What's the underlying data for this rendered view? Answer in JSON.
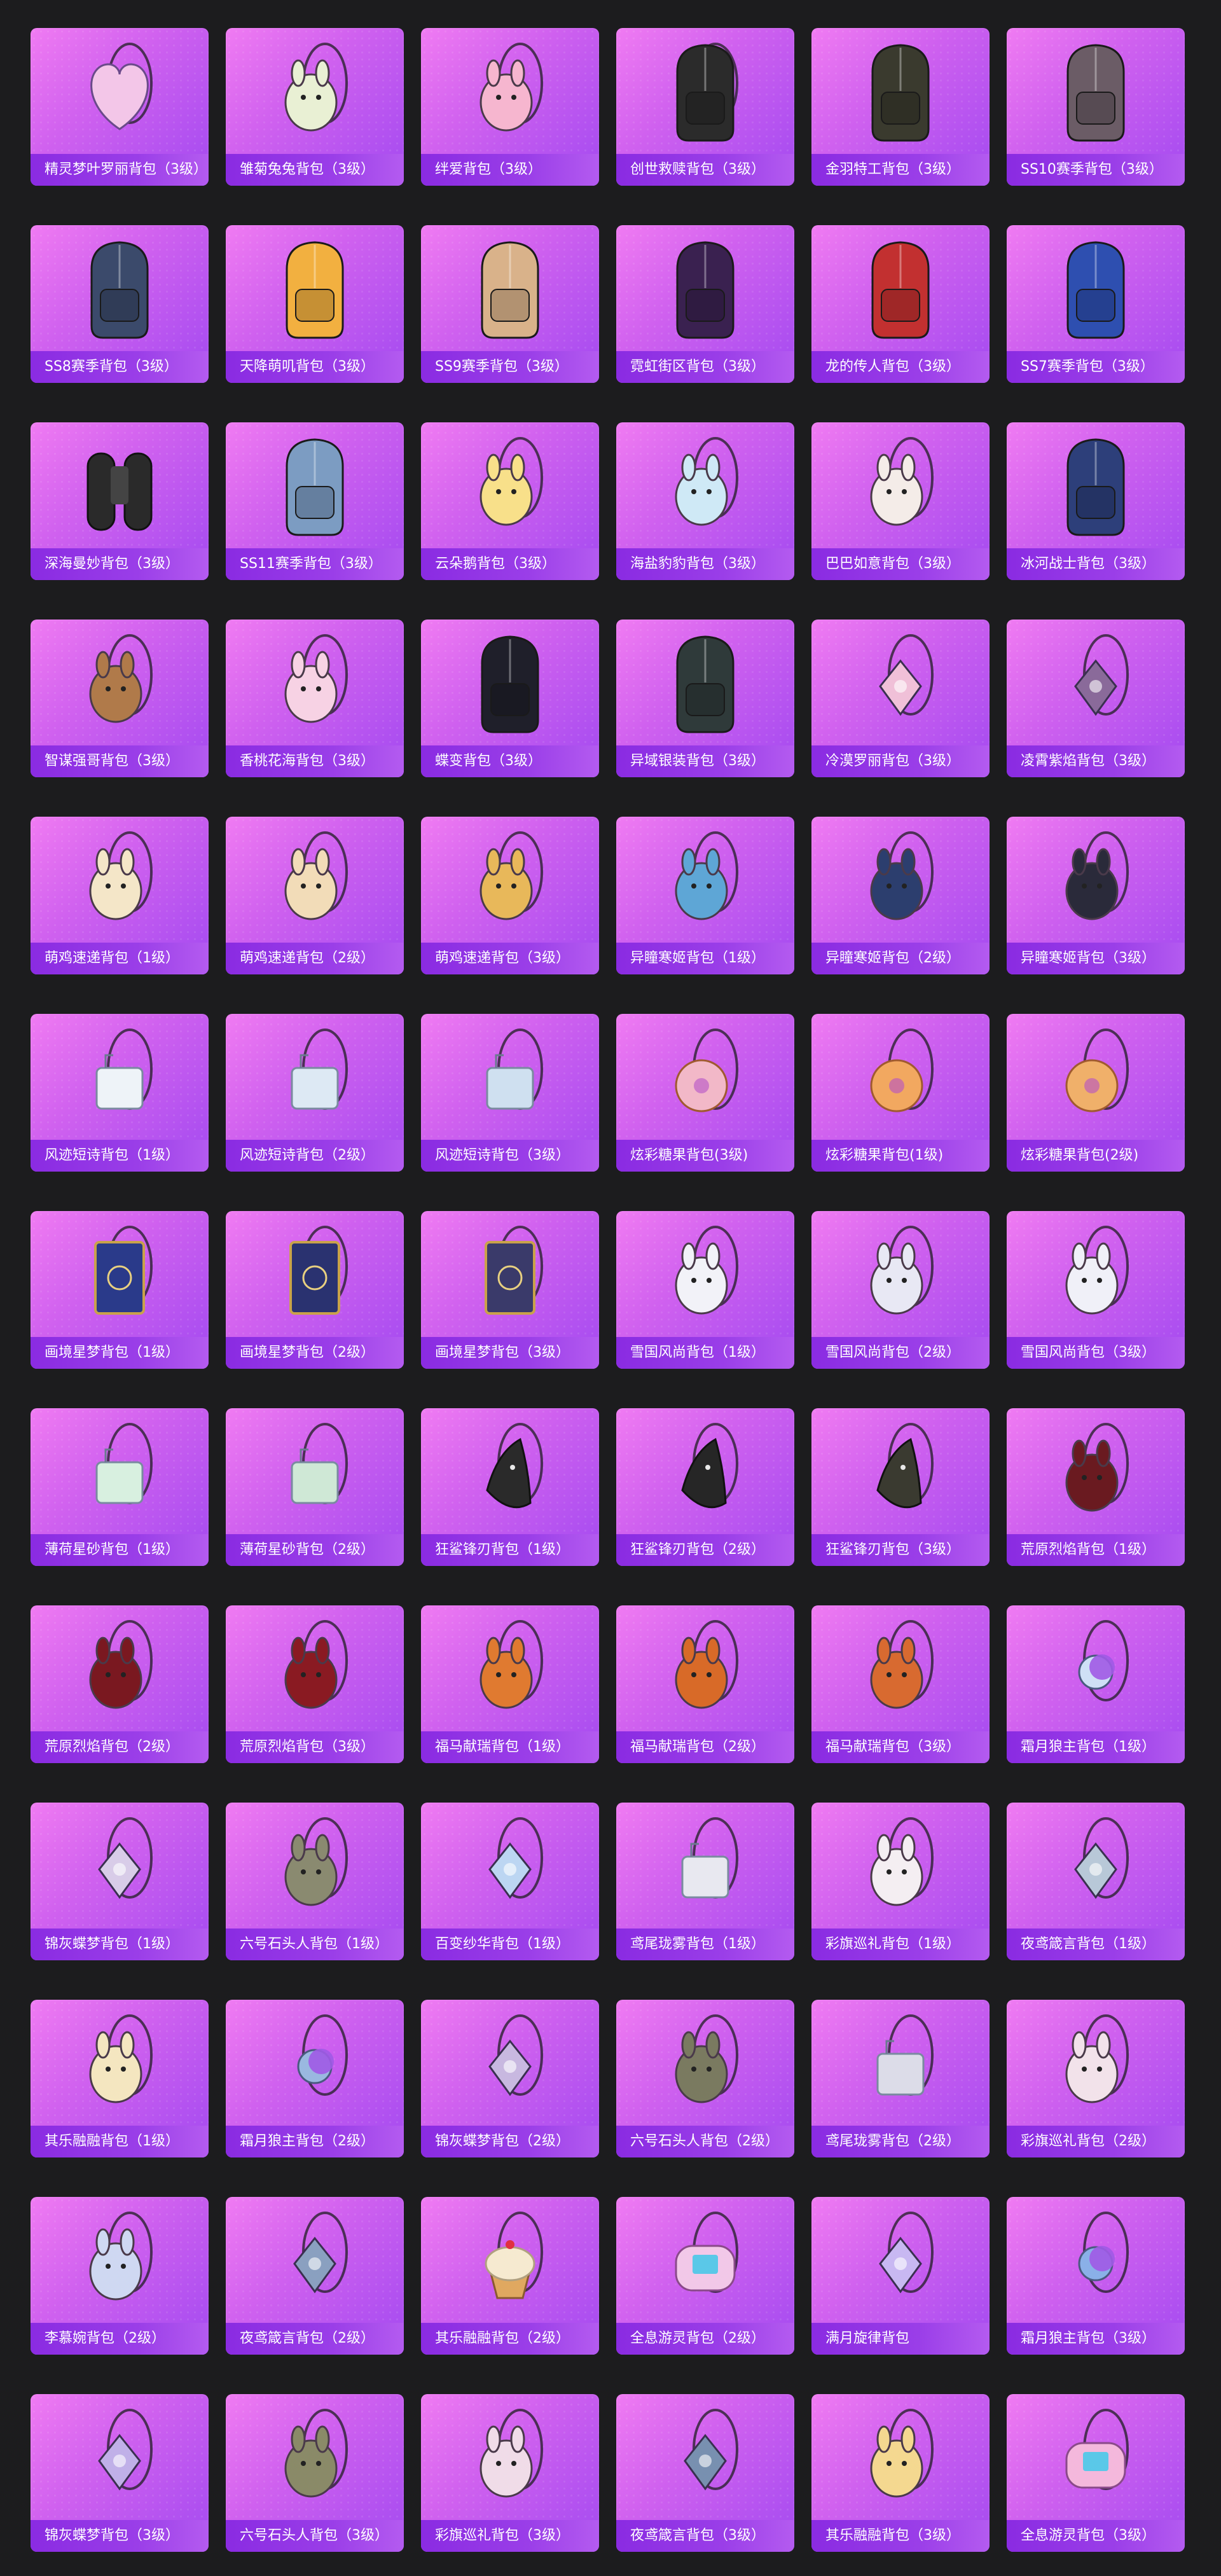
{
  "items": [
    {
      "label": "精灵梦叶罗丽背包（3级）",
      "icon": "heart-backpack-icon",
      "color": "#f3c6e8"
    },
    {
      "label": "雏菊兔兔背包（3级）",
      "icon": "bunny-backpack-icon",
      "color": "#e9f0d4"
    },
    {
      "label": "绊爱背包（3级）",
      "icon": "pink-backpack-icon",
      "color": "#f6b6cf"
    },
    {
      "label": "创世救赎背包（3级）",
      "icon": "armor-backpack-icon",
      "color": "#2b2b2b"
    },
    {
      "label": "金羽特工背包（3级）",
      "icon": "tactical-backpack-icon",
      "color": "#3a3a2e"
    },
    {
      "label": "SS10赛季背包（3级）",
      "icon": "backpack-icon",
      "color": "#6b5c66"
    },
    {
      "label": "SS8赛季背包（3级）",
      "icon": "backpack-icon",
      "color": "#3b4a6b"
    },
    {
      "label": "天降萌叽背包（3级）",
      "icon": "backpack-icon",
      "color": "#f2b040"
    },
    {
      "label": "SS9赛季背包（3级）",
      "icon": "backpack-icon",
      "color": "#d9b28a"
    },
    {
      "label": "霓虹街区背包（3级）",
      "icon": "backpack-icon",
      "color": "#3a2150"
    },
    {
      "label": "龙的传人背包（3级）",
      "icon": "backpack-icon",
      "color": "#c23030"
    },
    {
      "label": "SS7赛季背包（3级）",
      "icon": "backpack-icon",
      "color": "#2e4fb0"
    },
    {
      "label": "深海曼妙背包（3级）",
      "icon": "tank-backpack-icon",
      "color": "#2a2a2a"
    },
    {
      "label": "SS11赛季背包（3级）",
      "icon": "backpack-icon",
      "color": "#7c9cc2"
    },
    {
      "label": "云朵鹅背包（3级）",
      "icon": "plush-backpack-icon",
      "color": "#f8e08a"
    },
    {
      "label": "海盐豹豹背包（3级）",
      "icon": "plush-backpack-icon",
      "color": "#cfe9f6"
    },
    {
      "label": "巴巴如意背包（3级）",
      "icon": "plush-backpack-icon",
      "color": "#f4ece8"
    },
    {
      "label": "冰河战士背包（3级）",
      "icon": "backpack-icon",
      "color": "#2d3f7a"
    },
    {
      "label": "智谋强哥背包（3级）",
      "icon": "plush-backpack-icon",
      "color": "#b07a4a"
    },
    {
      "label": "香桃花海背包（3级）",
      "icon": "flower-backpack-icon",
      "color": "#f7d2e4"
    },
    {
      "label": "蝶变背包（3级）",
      "icon": "backpack-icon",
      "color": "#1f1f2a"
    },
    {
      "label": "异域银装背包（3级）",
      "icon": "backpack-icon",
      "color": "#2f3a3a"
    },
    {
      "label": "冷漠罗丽背包（3级）",
      "icon": "charm-backpack-icon",
      "color": "#f0c0d8"
    },
    {
      "label": "凌霄紫焰背包（3级）",
      "icon": "charm-backpack-icon",
      "color": "#8a6a9a"
    },
    {
      "label": "萌鸡速递背包（1级）",
      "icon": "chick-backpack-icon",
      "color": "#f4e6c8"
    },
    {
      "label": "萌鸡速递背包（2级）",
      "icon": "chick-backpack-icon",
      "color": "#f2dcb8"
    },
    {
      "label": "萌鸡速递背包（3级）",
      "icon": "chick-backpack-icon",
      "color": "#e8b85a"
    },
    {
      "label": "异瞳寒姬背包（1级）",
      "icon": "cat-backpack-icon",
      "color": "#5ea6d6"
    },
    {
      "label": "异瞳寒姬背包（2级）",
      "icon": "cat-backpack-icon",
      "color": "#2c3e6e"
    },
    {
      "label": "异瞳寒姬背包（3级）",
      "icon": "cat-backpack-icon",
      "color": "#2a2a3a"
    },
    {
      "label": "风迹短诗背包（1级）",
      "icon": "pouch-backpack-icon",
      "color": "#eef3f8"
    },
    {
      "label": "风迹短诗背包（2级）",
      "icon": "pouch-backpack-icon",
      "color": "#dde9f4"
    },
    {
      "label": "风迹短诗背包（3级）",
      "icon": "pouch-backpack-icon",
      "color": "#cfe0f0"
    },
    {
      "label": "炫彩糖果背包(3级)",
      "icon": "donut-backpack-icon",
      "color": "#f2b8c8"
    },
    {
      "label": "炫彩糖果背包(1级)",
      "icon": "donut-backpack-icon",
      "color": "#f2a860"
    },
    {
      "label": "炫彩糖果背包(2级)",
      "icon": "donut-backpack-icon",
      "color": "#f0b06a"
    },
    {
      "label": "画境星梦背包（1级）",
      "icon": "book-backpack-icon",
      "color": "#2a3a8a"
    },
    {
      "label": "画境星梦背包（2级）",
      "icon": "book-backpack-icon",
      "color": "#2a3270"
    },
    {
      "label": "画境星梦背包（3级）",
      "icon": "book-backpack-icon",
      "color": "#3a3a6a"
    },
    {
      "label": "雪国风尚背包（1级）",
      "icon": "snowman-backpack-icon",
      "color": "#f2f2f8"
    },
    {
      "label": "雪国风尚背包（2级）",
      "icon": "snowman-backpack-icon",
      "color": "#e8e8f4"
    },
    {
      "label": "雪国风尚背包（3级）",
      "icon": "snowman-backpack-icon",
      "color": "#f0f0f8"
    },
    {
      "label": "薄荷星砂背包（1级）",
      "icon": "pouch-backpack-icon",
      "color": "#d8f0e0"
    },
    {
      "label": "薄荷星砂背包（2级）",
      "icon": "pouch-backpack-icon",
      "color": "#cfe8d6"
    },
    {
      "label": "狂鲨锋刃背包（1级）",
      "icon": "shark-backpack-icon",
      "color": "#2a2a2a"
    },
    {
      "label": "狂鲨锋刃背包（2级）",
      "icon": "shark-backpack-icon",
      "color": "#262626"
    },
    {
      "label": "狂鲨锋刃背包（3级）",
      "icon": "shark-backpack-icon",
      "color": "#3a3a30"
    },
    {
      "label": "荒原烈焰背包（1级）",
      "icon": "rabbit-backpack-icon",
      "color": "#6a1a20"
    },
    {
      "label": "荒原烈焰背包（2级）",
      "icon": "rabbit-backpack-icon",
      "color": "#7a1820"
    },
    {
      "label": "荒原烈焰背包（3级）",
      "icon": "rabbit-backpack-icon",
      "color": "#8a1a22"
    },
    {
      "label": "福马献瑞背包（1级）",
      "icon": "horse-backpack-icon",
      "color": "#e07a30"
    },
    {
      "label": "福马献瑞背包（2级）",
      "icon": "horse-backpack-icon",
      "color": "#d86a28"
    },
    {
      "label": "福马献瑞背包（3级）",
      "icon": "horse-backpack-icon",
      "color": "#d86a30"
    },
    {
      "label": "霜月狼主背包（1级）",
      "icon": "moon-backpack-icon",
      "color": "#cfe0f6"
    },
    {
      "label": "锦灰蝶梦背包（1级）",
      "icon": "charm-backpack-icon",
      "color": "#d8cce8"
    },
    {
      "label": "六号石头人背包（1级）",
      "icon": "stone-backpack-icon",
      "color": "#8a8a70"
    },
    {
      "label": "百变纱华背包（1级）",
      "icon": "charm-backpack-icon",
      "color": "#bcd6f2"
    },
    {
      "label": "鸢尾珑雾背包（1级）",
      "icon": "pouch-backpack-icon",
      "color": "#e8e8f0"
    },
    {
      "label": "彩旗巡礼背包（1级）",
      "icon": "plush-backpack-icon",
      "color": "#f4eef2"
    },
    {
      "label": "夜鸢箴言背包（1级）",
      "icon": "charm-backpack-icon",
      "color": "#b8c8d8"
    },
    {
      "label": "其乐融融背包（1级）",
      "icon": "plush-backpack-icon",
      "color": "#f4e6c0"
    },
    {
      "label": "霜月狼主背包（2级）",
      "icon": "moon-backpack-icon",
      "color": "#9ab8e0"
    },
    {
      "label": "锦灰蝶梦背包（2级）",
      "icon": "charm-backpack-icon",
      "color": "#c8b8e0"
    },
    {
      "label": "六号石头人背包（2级）",
      "icon": "stone-backpack-icon",
      "color": "#7a7a60"
    },
    {
      "label": "鸢尾珑雾背包（2级）",
      "icon": "pouch-backpack-icon",
      "color": "#dcdce8"
    },
    {
      "label": "彩旗巡礼背包（2级）",
      "icon": "plush-backpack-icon",
      "color": "#f2e2ea"
    },
    {
      "label": "李慕婉背包（2级）",
      "icon": "plush-backpack-icon",
      "color": "#cfd8f2"
    },
    {
      "label": "夜鸢箴言背包（2级）",
      "icon": "charm-backpack-icon",
      "color": "#8aa0c0"
    },
    {
      "label": "其乐融融背包（2级）",
      "icon": "cupcake-backpack-icon",
      "color": "#f6ead0"
    },
    {
      "label": "全息游灵背包（2级）",
      "icon": "console-backpack-icon",
      "color": "#f2c8e8"
    },
    {
      "label": "满月旋律背包",
      "icon": "charm-backpack-icon",
      "color": "#c8b8f2"
    },
    {
      "label": "霜月狼主背包（3级）",
      "icon": "moon-backpack-icon",
      "color": "#8ab0e8"
    },
    {
      "label": "锦灰蝶梦背包（3级）",
      "icon": "charm-backpack-icon",
      "color": "#c0b0e8"
    },
    {
      "label": "六号石头人背包（3级）",
      "icon": "stone-backpack-icon",
      "color": "#8a8a68"
    },
    {
      "label": "彩旗巡礼背包（3级）",
      "icon": "plush-backpack-icon",
      "color": "#f0dce8"
    },
    {
      "label": "夜鸢箴言背包（3级）",
      "icon": "charm-backpack-icon",
      "color": "#7890b0"
    },
    {
      "label": "其乐融融背包（3级）",
      "icon": "plush-backpack-icon",
      "color": "#f4d890"
    },
    {
      "label": "全息游灵背包（3级）",
      "icon": "console-backpack-icon",
      "color": "#f4b8dc"
    }
  ]
}
